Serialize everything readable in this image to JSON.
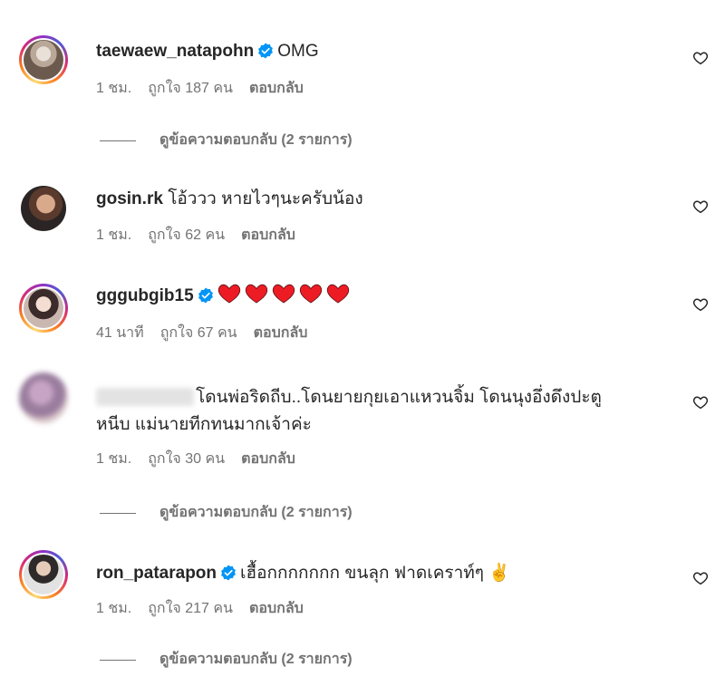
{
  "comments": [
    {
      "username": "taewaew_natapohn",
      "verified": true,
      "text": "OMG",
      "time": "1 ชม.",
      "likes": "ถูกใจ 187 คน",
      "reply": "ตอบกลับ",
      "view_replies": "ดูข้อความตอบกลับ (2 รายการ)"
    },
    {
      "username": "gosin.rk",
      "verified": false,
      "text": "โอ้ววว หายไวๆนะครับน้อง",
      "time": "1 ชม.",
      "likes": "ถูกใจ 62 คน",
      "reply": "ตอบกลับ"
    },
    {
      "username": "gggubgib15",
      "verified": true,
      "text": "❤️❤️❤️❤️❤️",
      "time": "41 นาที",
      "likes": "ถูกใจ 67 คน",
      "reply": "ตอบกลับ"
    },
    {
      "username": "",
      "verified": false,
      "text_line1": "โดนพ่อริดถีบ..โดนยายกุยเอาแหวนจิ้ม โดนนุงอึ่งดึงปะตู",
      "text_line2": "หนีบ แม่นายทีกทนมากเจ้าค่ะ",
      "time": "1 ชม.",
      "likes": "ถูกใจ 30 คน",
      "reply": "ตอบกลับ",
      "view_replies": "ดูข้อความตอบกลับ (2 รายการ)"
    },
    {
      "username": "ron_patarapon",
      "verified": true,
      "text": "เฮื้อกกกกกกก ขนลุก ฟาดเคราท์ๆ ✌️",
      "time": "1 ชม.",
      "likes": "ถูกใจ 217 คน",
      "reply": "ตอบกลับ",
      "view_replies": "ดูข้อความตอบกลับ (2 รายการ)"
    }
  ],
  "colors": {
    "text": "#262626",
    "secondary": "#737373",
    "verified": "#0095f6",
    "heart": "#ed1c24"
  }
}
